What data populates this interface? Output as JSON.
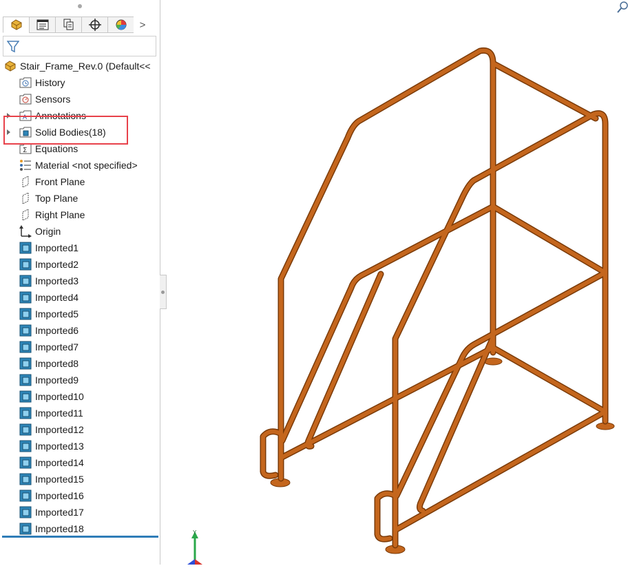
{
  "feature_tree": {
    "tabs": [
      {
        "name": "featuremanager-tab-icon"
      },
      {
        "name": "propertymanager-tab-icon"
      },
      {
        "name": "configurationmanager-tab-icon"
      },
      {
        "name": "dimxpert-tab-icon"
      },
      {
        "name": "display-manager-tab-icon"
      }
    ],
    "more_tabs": ">",
    "root_label": "Stair_Frame_Rev.0  (Default<<",
    "items": [
      {
        "label": "History",
        "icon": "history-icon"
      },
      {
        "label": "Sensors",
        "icon": "sensors-icon"
      },
      {
        "label": "Annotations",
        "icon": "annotations-icon"
      },
      {
        "label": "Solid Bodies(18)",
        "icon": "solid-bodies-folder-icon"
      },
      {
        "label": "Equations",
        "icon": "equations-icon"
      },
      {
        "label": "Material <not specified>",
        "icon": "material-icon"
      },
      {
        "label": "Front Plane",
        "icon": "plane-icon"
      },
      {
        "label": "Top Plane",
        "icon": "plane-icon"
      },
      {
        "label": "Right Plane",
        "icon": "plane-icon"
      },
      {
        "label": "Origin",
        "icon": "origin-icon"
      },
      {
        "label": "Imported1",
        "icon": "imported-body-icon"
      },
      {
        "label": "Imported2",
        "icon": "imported-body-icon"
      },
      {
        "label": "Imported3",
        "icon": "imported-body-icon"
      },
      {
        "label": "Imported4",
        "icon": "imported-body-icon"
      },
      {
        "label": "Imported5",
        "icon": "imported-body-icon"
      },
      {
        "label": "Imported6",
        "icon": "imported-body-icon"
      },
      {
        "label": "Imported7",
        "icon": "imported-body-icon"
      },
      {
        "label": "Imported8",
        "icon": "imported-body-icon"
      },
      {
        "label": "Imported9",
        "icon": "imported-body-icon"
      },
      {
        "label": "Imported10",
        "icon": "imported-body-icon"
      },
      {
        "label": "Imported11",
        "icon": "imported-body-icon"
      },
      {
        "label": "Imported12",
        "icon": "imported-body-icon"
      },
      {
        "label": "Imported13",
        "icon": "imported-body-icon"
      },
      {
        "label": "Imported14",
        "icon": "imported-body-icon"
      },
      {
        "label": "Imported15",
        "icon": "imported-body-icon"
      },
      {
        "label": "Imported16",
        "icon": "imported-body-icon"
      },
      {
        "label": "Imported17",
        "icon": "imported-body-icon"
      },
      {
        "label": "Imported18",
        "icon": "imported-body-icon"
      }
    ]
  },
  "colors": {
    "model_tube": "#c4661d",
    "highlight_box": "#e8414a",
    "selection_line": "#2f7db8",
    "body_icon": "#2e86b8"
  }
}
